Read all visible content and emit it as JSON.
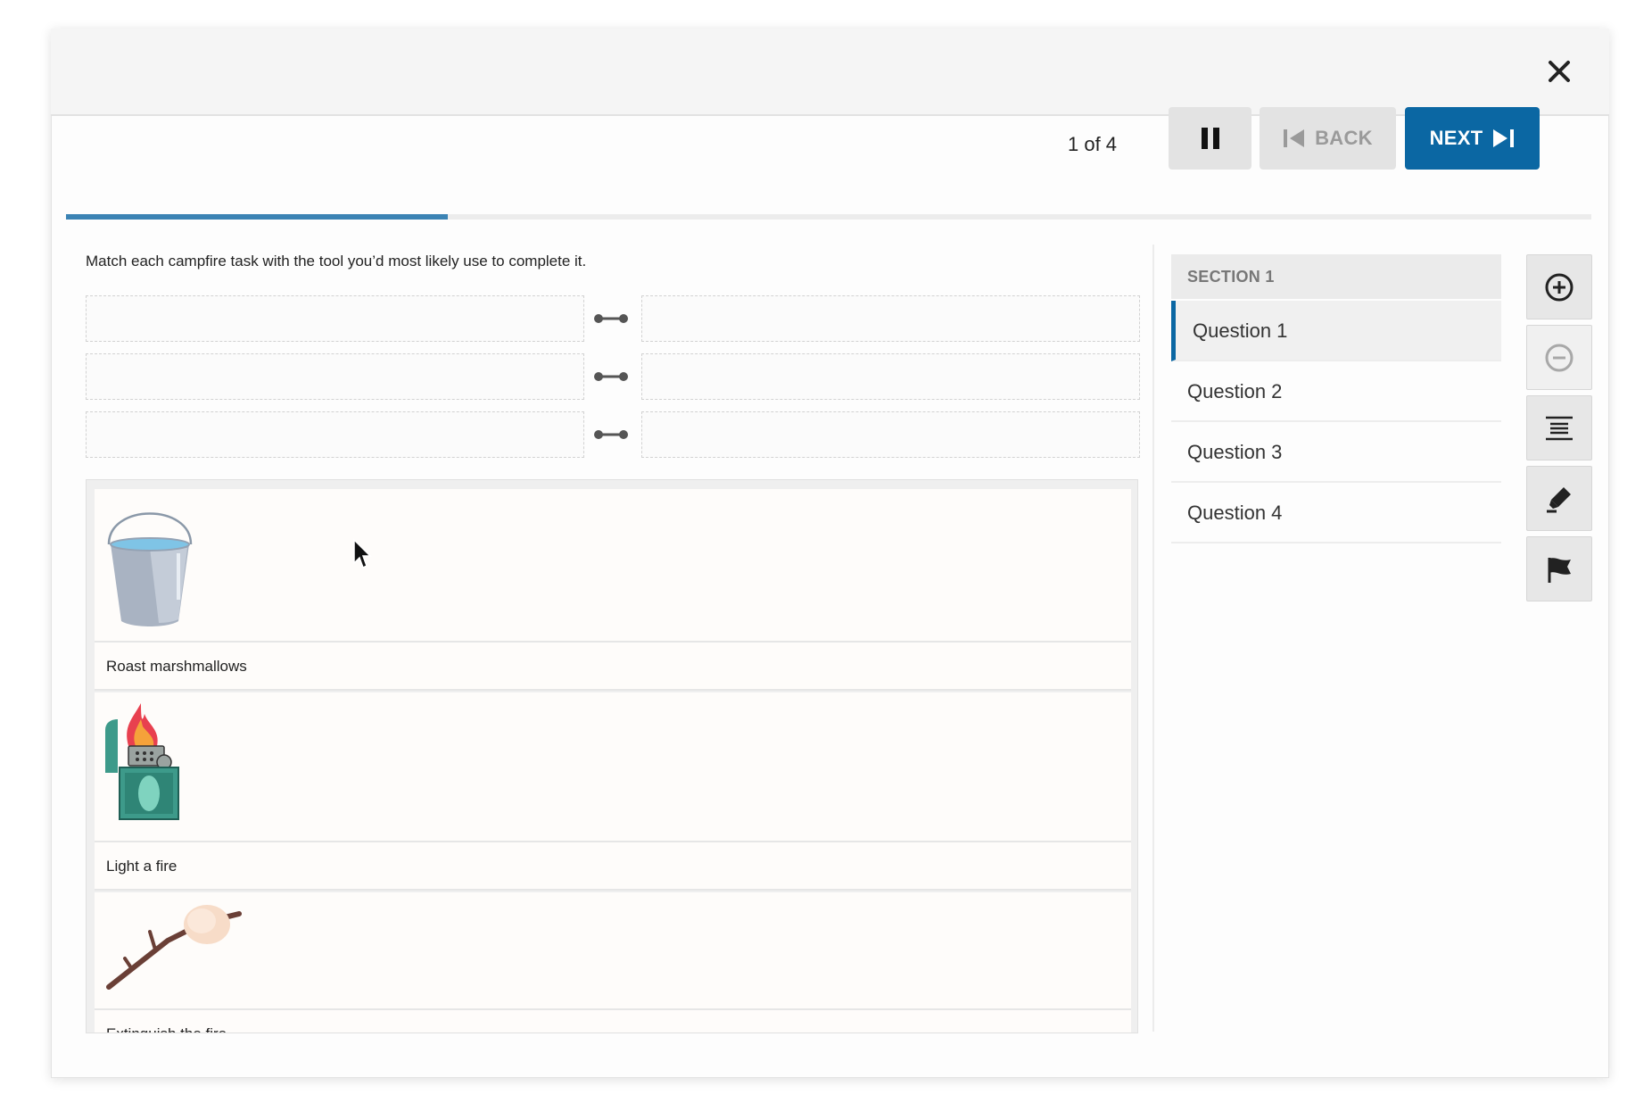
{
  "header": {
    "counter": "1 of 4",
    "back_label": "BACK",
    "next_label": "NEXT",
    "progress_fraction": 0.25
  },
  "prompt": "Match each campfire task with the tool you’d most likely use to complete it.",
  "pairs": [
    {
      "left": "",
      "right": ""
    },
    {
      "left": "",
      "right": ""
    },
    {
      "left": "",
      "right": ""
    }
  ],
  "bank": {
    "items": [
      {
        "icon": "water-bucket-icon",
        "label": "Roast marshmallows"
      },
      {
        "icon": "lighter-icon",
        "label": "Light a fire"
      },
      {
        "icon": "marshmallow-stick-icon",
        "label": "Extinguish the fire"
      }
    ]
  },
  "sidebar": {
    "section_title": "SECTION 1",
    "questions": [
      "Question 1",
      "Question 2",
      "Question 3",
      "Question 4"
    ],
    "active_index": 0
  },
  "tools": [
    "zoom-in-icon",
    "zoom-out-icon",
    "line-reader-icon",
    "highlighter-icon",
    "flag-icon"
  ],
  "colors": {
    "accent": "#0b67a3",
    "progress": "#3b83b4",
    "button_gray": "#e3e3e3"
  }
}
